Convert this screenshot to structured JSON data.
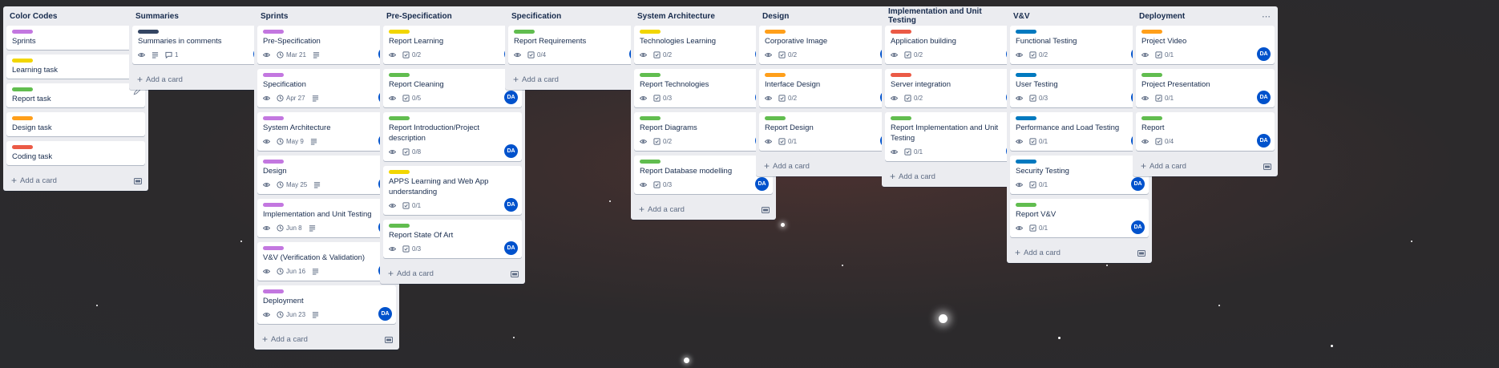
{
  "colors": {
    "purple": "#c377e0",
    "yellow": "#f2d600",
    "green": "#61bd4f",
    "orange": "#ff9f1a",
    "red": "#eb5a46",
    "blue": "#0079bf",
    "navy": "#344563",
    "avatar": "#0052cc"
  },
  "icons": {
    "watch": "eye-icon",
    "description": "description-icon",
    "comments": "comment-icon",
    "due": "clock-icon",
    "checklist": "checklist-icon",
    "menu": "ellipsis-icon",
    "add": "plus-icon",
    "template": "card-template-icon",
    "edit": "pencil-icon"
  },
  "add_card_label": "Add a card",
  "avatar_initials": "DA",
  "lists": [
    {
      "title": "Color Codes",
      "cards": [
        {
          "title": "Sprints",
          "label": "purple"
        },
        {
          "title": "Learning task",
          "label": "yellow"
        },
        {
          "title": "Report task",
          "label": "green",
          "edit": true
        },
        {
          "title": "Design task",
          "label": "orange"
        },
        {
          "title": "Coding task",
          "label": "red"
        }
      ]
    },
    {
      "title": "Summaries",
      "cards": [
        {
          "title": "Summaries in comments",
          "label": "navy",
          "watch": true,
          "description": true,
          "comments": "1",
          "avatar": true
        }
      ]
    },
    {
      "title": "Sprints",
      "cards": [
        {
          "title": "Pre-Specification",
          "label": "purple",
          "watch": true,
          "due": "Mar 21",
          "description": true,
          "avatar": true
        },
        {
          "title": "Specification",
          "label": "purple",
          "watch": true,
          "due": "Apr 27",
          "description": true,
          "avatar": true
        },
        {
          "title": "System Architecture",
          "label": "purple",
          "watch": true,
          "due": "May 9",
          "description": true,
          "avatar": true
        },
        {
          "title": "Design",
          "label": "purple",
          "watch": true,
          "due": "May 25",
          "description": true,
          "avatar": true
        },
        {
          "title": "Implementation and Unit Testing",
          "label": "purple",
          "watch": true,
          "due": "Jun 8",
          "description": true,
          "avatar": true
        },
        {
          "title": "V&V (Verification & Validation)",
          "label": "purple",
          "watch": true,
          "due": "Jun 16",
          "description": true,
          "avatar": true
        },
        {
          "title": "Deployment",
          "label": "purple",
          "watch": true,
          "due": "Jun 23",
          "description": true,
          "avatar": true
        }
      ]
    },
    {
      "title": "Pre-Specification",
      "cards": [
        {
          "title": "Report Learning",
          "label": "yellow",
          "watch": true,
          "checklist": "0/2",
          "avatar": true
        },
        {
          "title": "Report Cleaning",
          "label": "green",
          "watch": true,
          "checklist": "0/5",
          "avatar": true
        },
        {
          "title": "Report Introduction/Project description",
          "label": "green",
          "watch": true,
          "checklist": "0/8",
          "avatar": true
        },
        {
          "title": "APPS Learning and Web App understanding",
          "label": "yellow",
          "watch": true,
          "checklist": "0/1",
          "avatar": true
        },
        {
          "title": "Report State Of Art",
          "label": "green",
          "watch": true,
          "checklist": "0/3",
          "avatar": true
        }
      ]
    },
    {
      "title": "Specification",
      "cards": [
        {
          "title": "Report Requirements",
          "label": "green",
          "watch": true,
          "checklist": "0/4",
          "avatar": true
        }
      ]
    },
    {
      "title": "System Architecture",
      "cards": [
        {
          "title": "Technologies Learning",
          "label": "yellow",
          "watch": true,
          "checklist": "0/2",
          "avatar": true
        },
        {
          "title": "Report Technologies",
          "label": "green",
          "watch": true,
          "checklist": "0/3",
          "avatar": true
        },
        {
          "title": "Report Diagrams",
          "label": "green",
          "watch": true,
          "checklist": "0/2",
          "avatar": true
        },
        {
          "title": "Report Database modelling",
          "label": "green",
          "watch": true,
          "checklist": "0/3",
          "avatar": true
        }
      ]
    },
    {
      "title": "Design",
      "cards": [
        {
          "title": "Corporative Image",
          "label": "orange",
          "watch": true,
          "checklist": "0/2",
          "avatar": true
        },
        {
          "title": "Interface Design",
          "label": "orange",
          "watch": true,
          "checklist": "0/2",
          "avatar": true
        },
        {
          "title": "Report Design",
          "label": "green",
          "watch": true,
          "checklist": "0/1",
          "avatar": true
        }
      ]
    },
    {
      "title": "Implementation and Unit Testing",
      "cards": [
        {
          "title": "Application building",
          "label": "red",
          "watch": true,
          "checklist": "0/2",
          "avatar": true
        },
        {
          "title": "Server integration",
          "label": "red",
          "watch": true,
          "checklist": "0/2",
          "avatar": true
        },
        {
          "title": "Report Implementation and Unit Testing",
          "label": "green",
          "watch": true,
          "checklist": "0/1",
          "avatar": true
        }
      ]
    },
    {
      "title": "V&V",
      "cards": [
        {
          "title": "Functional Testing",
          "label": "blue",
          "watch": true,
          "checklist": "0/2",
          "avatar": true
        },
        {
          "title": "User Testing",
          "label": "blue",
          "watch": true,
          "checklist": "0/3",
          "avatar": true
        },
        {
          "title": "Performance and Load Testing",
          "label": "blue",
          "watch": true,
          "checklist": "0/1",
          "avatar": true
        },
        {
          "title": "Security Testing",
          "label": "blue",
          "watch": true,
          "checklist": "0/1",
          "avatar": true
        },
        {
          "title": "Report V&V",
          "label": "green",
          "watch": true,
          "checklist": "0/1",
          "avatar": true
        }
      ]
    },
    {
      "title": "Deployment",
      "cards": [
        {
          "title": "Project Video",
          "label": "orange",
          "watch": true,
          "checklist": "0/1",
          "avatar": true
        },
        {
          "title": "Project Presentation",
          "label": "green",
          "watch": true,
          "checklist": "0/1",
          "avatar": true
        },
        {
          "title": "Report",
          "label": "green",
          "watch": true,
          "checklist": "0/4",
          "avatar": true
        }
      ]
    }
  ]
}
